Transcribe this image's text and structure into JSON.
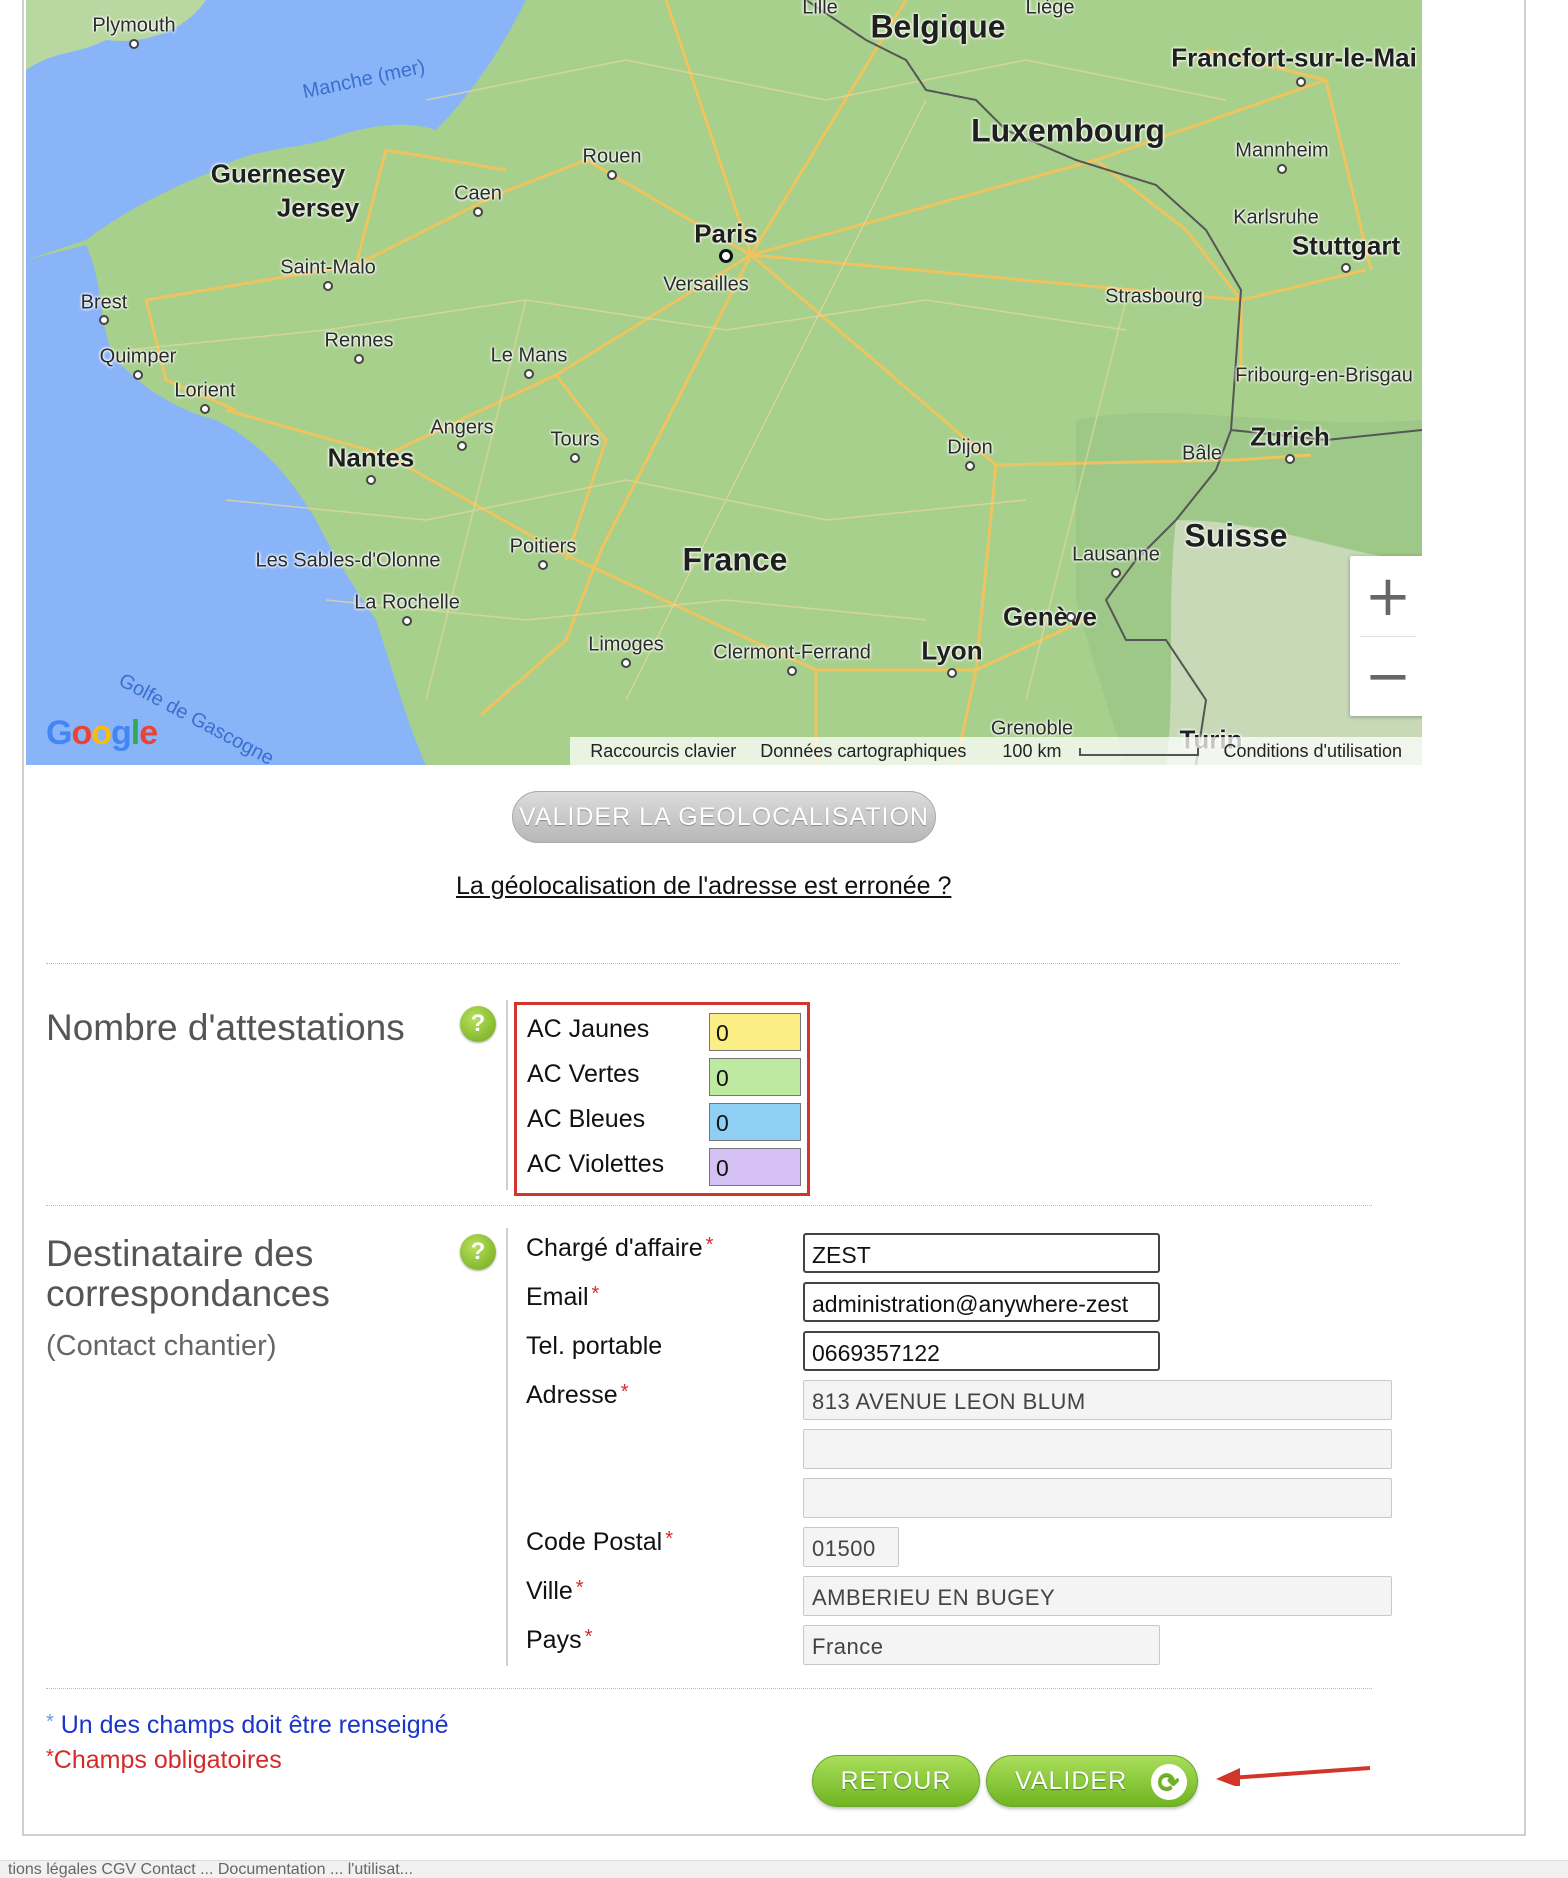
{
  "map": {
    "cities": [
      {
        "name": "Plymouth",
        "kind": "city"
      },
      {
        "name": "Lille",
        "kind": "city"
      },
      {
        "name": "Belgique",
        "kind": "country"
      },
      {
        "name": "Liège",
        "kind": "city"
      },
      {
        "name": "Francfort-sur-le-Mai",
        "kind": "region"
      },
      {
        "name": "Manche (mer)",
        "kind": "sea"
      },
      {
        "name": "Luxembourg",
        "kind": "country"
      },
      {
        "name": "Mannheim",
        "kind": "city"
      },
      {
        "name": "Guernesey",
        "kind": "region"
      },
      {
        "name": "Jersey",
        "kind": "region"
      },
      {
        "name": "Rouen",
        "kind": "city"
      },
      {
        "name": "Caen",
        "kind": "city"
      },
      {
        "name": "Paris",
        "kind": "capital"
      },
      {
        "name": "Karlsruhe",
        "kind": "city"
      },
      {
        "name": "Stuttgart",
        "kind": "region"
      },
      {
        "name": "Saint-Malo",
        "kind": "city"
      },
      {
        "name": "Versailles",
        "kind": "city"
      },
      {
        "name": "Strasbourg",
        "kind": "city"
      },
      {
        "name": "Brest",
        "kind": "city"
      },
      {
        "name": "Rennes",
        "kind": "city"
      },
      {
        "name": "Le Mans",
        "kind": "city"
      },
      {
        "name": "Quimper",
        "kind": "city"
      },
      {
        "name": "Fribourg-en-Brisgau",
        "kind": "city"
      },
      {
        "name": "Lorient",
        "kind": "city"
      },
      {
        "name": "Angers",
        "kind": "city"
      },
      {
        "name": "Tours",
        "kind": "city"
      },
      {
        "name": "Dijon",
        "kind": "city"
      },
      {
        "name": "Bâle",
        "kind": "city"
      },
      {
        "name": "Zurich",
        "kind": "region"
      },
      {
        "name": "Nantes",
        "kind": "region"
      },
      {
        "name": "Suisse",
        "kind": "country"
      },
      {
        "name": "Poitiers",
        "kind": "city"
      },
      {
        "name": "France",
        "kind": "country"
      },
      {
        "name": "Lausanne",
        "kind": "city"
      },
      {
        "name": "Les Sables-d'Olonne",
        "kind": "city"
      },
      {
        "name": "La Rochelle",
        "kind": "city"
      },
      {
        "name": "Genève",
        "kind": "region"
      },
      {
        "name": "Limoges",
        "kind": "city"
      },
      {
        "name": "Clermont-Ferrand",
        "kind": "city"
      },
      {
        "name": "Lyon",
        "kind": "region"
      },
      {
        "name": "Golfe de Gascogne",
        "kind": "sea"
      },
      {
        "name": "Grenoble",
        "kind": "city"
      },
      {
        "name": "Turin",
        "kind": "city"
      }
    ],
    "footer": {
      "shortcuts": "Raccourcis clavier",
      "map_data": "Données cartographiques",
      "scale": "100 km",
      "terms": "Conditions d'utilisation"
    },
    "logo": "Google",
    "colors": {
      "water": "#8ab4f8",
      "land": "#a8d08d",
      "roads": "#f3c35b"
    }
  },
  "geolocation": {
    "validate_button": "VALIDER LA GEOLOCALISATION",
    "error_link": "La géolocalisation de l'adresse est erronée ?"
  },
  "attestations": {
    "title": "Nombre d'attestations",
    "items": [
      {
        "label": "AC Jaunes",
        "value": "0",
        "color": "#fbee85"
      },
      {
        "label": "AC Vertes",
        "value": "0",
        "color": "#bdeaa0"
      },
      {
        "label": "AC Bleues",
        "value": "0",
        "color": "#8fcff3"
      },
      {
        "label": "AC Violettes",
        "value": "0",
        "color": "#d4c0f3"
      }
    ]
  },
  "recipient": {
    "title": "Destinataire des correspondances",
    "title_line1": "Destinataire des",
    "title_line2": "correspondances",
    "subtitle": "(Contact chantier)",
    "fields": {
      "manager_label": "Chargé d'affaire",
      "manager_value": "ZEST",
      "email_label": "Email",
      "email_value": "administration@anywhere-zest",
      "phone_label": "Tel. portable",
      "phone_value": "0669357122",
      "address_label": "Adresse",
      "address_line1": "813 AVENUE LEON BLUM",
      "address_line2": "",
      "address_line3": "",
      "zip_label": "Code Postal",
      "zip_value": "01500",
      "city_label": "Ville",
      "city_value": "AMBERIEU EN BUGEY",
      "country_label": "Pays",
      "country_value": "France"
    },
    "required_mark": "*"
  },
  "legend": {
    "one_required": "Un des champs doit être renseigné",
    "mandatory": "Champs obligatoires",
    "star": "*"
  },
  "actions": {
    "back": "RETOUR",
    "validate": "VALIDER"
  },
  "footer_strip": "tions légales  CGV  Contact  ...  Documentation  ...  l'utilisat..."
}
